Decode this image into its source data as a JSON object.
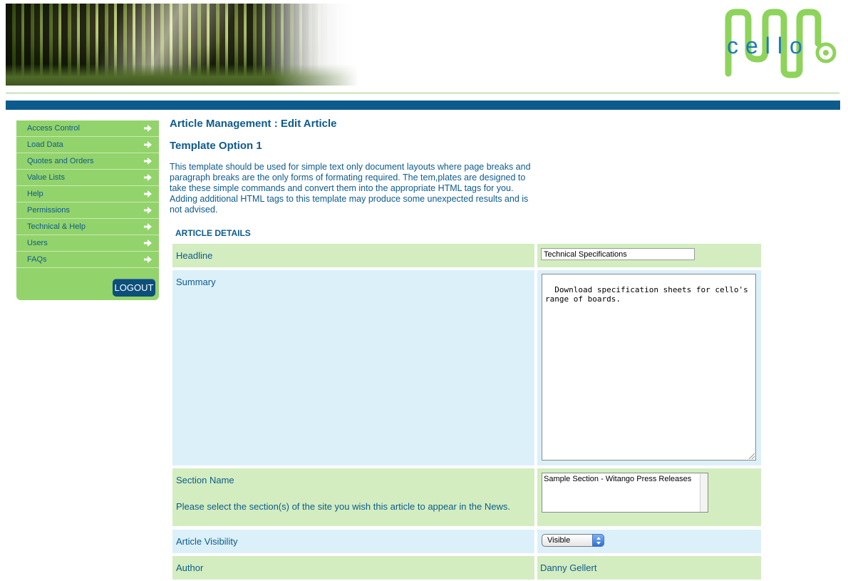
{
  "header": {
    "banner_alt": "forest-banner",
    "logo_word": "cello"
  },
  "sidebar": {
    "items": [
      {
        "label": "Access Control"
      },
      {
        "label": "Load Data"
      },
      {
        "label": "Quotes and Orders"
      },
      {
        "label": "Value Lists"
      },
      {
        "label": "Help"
      },
      {
        "label": "Permissions"
      },
      {
        "label": "Technical & Help"
      },
      {
        "label": "Users"
      },
      {
        "label": "FAQs"
      }
    ],
    "logout_label": "LOGOUT"
  },
  "main": {
    "page_title": "Article Management : Edit Article",
    "template_title": "Template Option 1",
    "intro": "This template should be used for simple text only document layouts where page breaks and paragraph breaks are the only forms of formating required. The tem,plates are designed to take these simple commands and convert them into the appropriate HTML tags for you. Adding additional HTML tags to this template may produce some unexpected results and is not advised.",
    "section_heading": "ARTICLE DETAILS",
    "fields": {
      "headline_label": "Headline",
      "headline_value": "Technical Specifications",
      "summary_label": "Summary",
      "summary_value": "Download specification sheets for cello's range of boards.",
      "section_name_label": "Section Name",
      "section_name_help": "Please select the section(s) of the site you wish this article to appear in the News.",
      "section_option": "Sample Section - Witango Press Releases",
      "visibility_label": "Article Visibility",
      "visibility_value": "Visible",
      "author_label": "Author",
      "author_value": "Danny Gellert"
    }
  },
  "colors": {
    "brand_blue": "#0d5b8c",
    "brand_green": "#93d36b",
    "row_green": "#d3edc0",
    "row_blue": "#dcf0fa"
  }
}
